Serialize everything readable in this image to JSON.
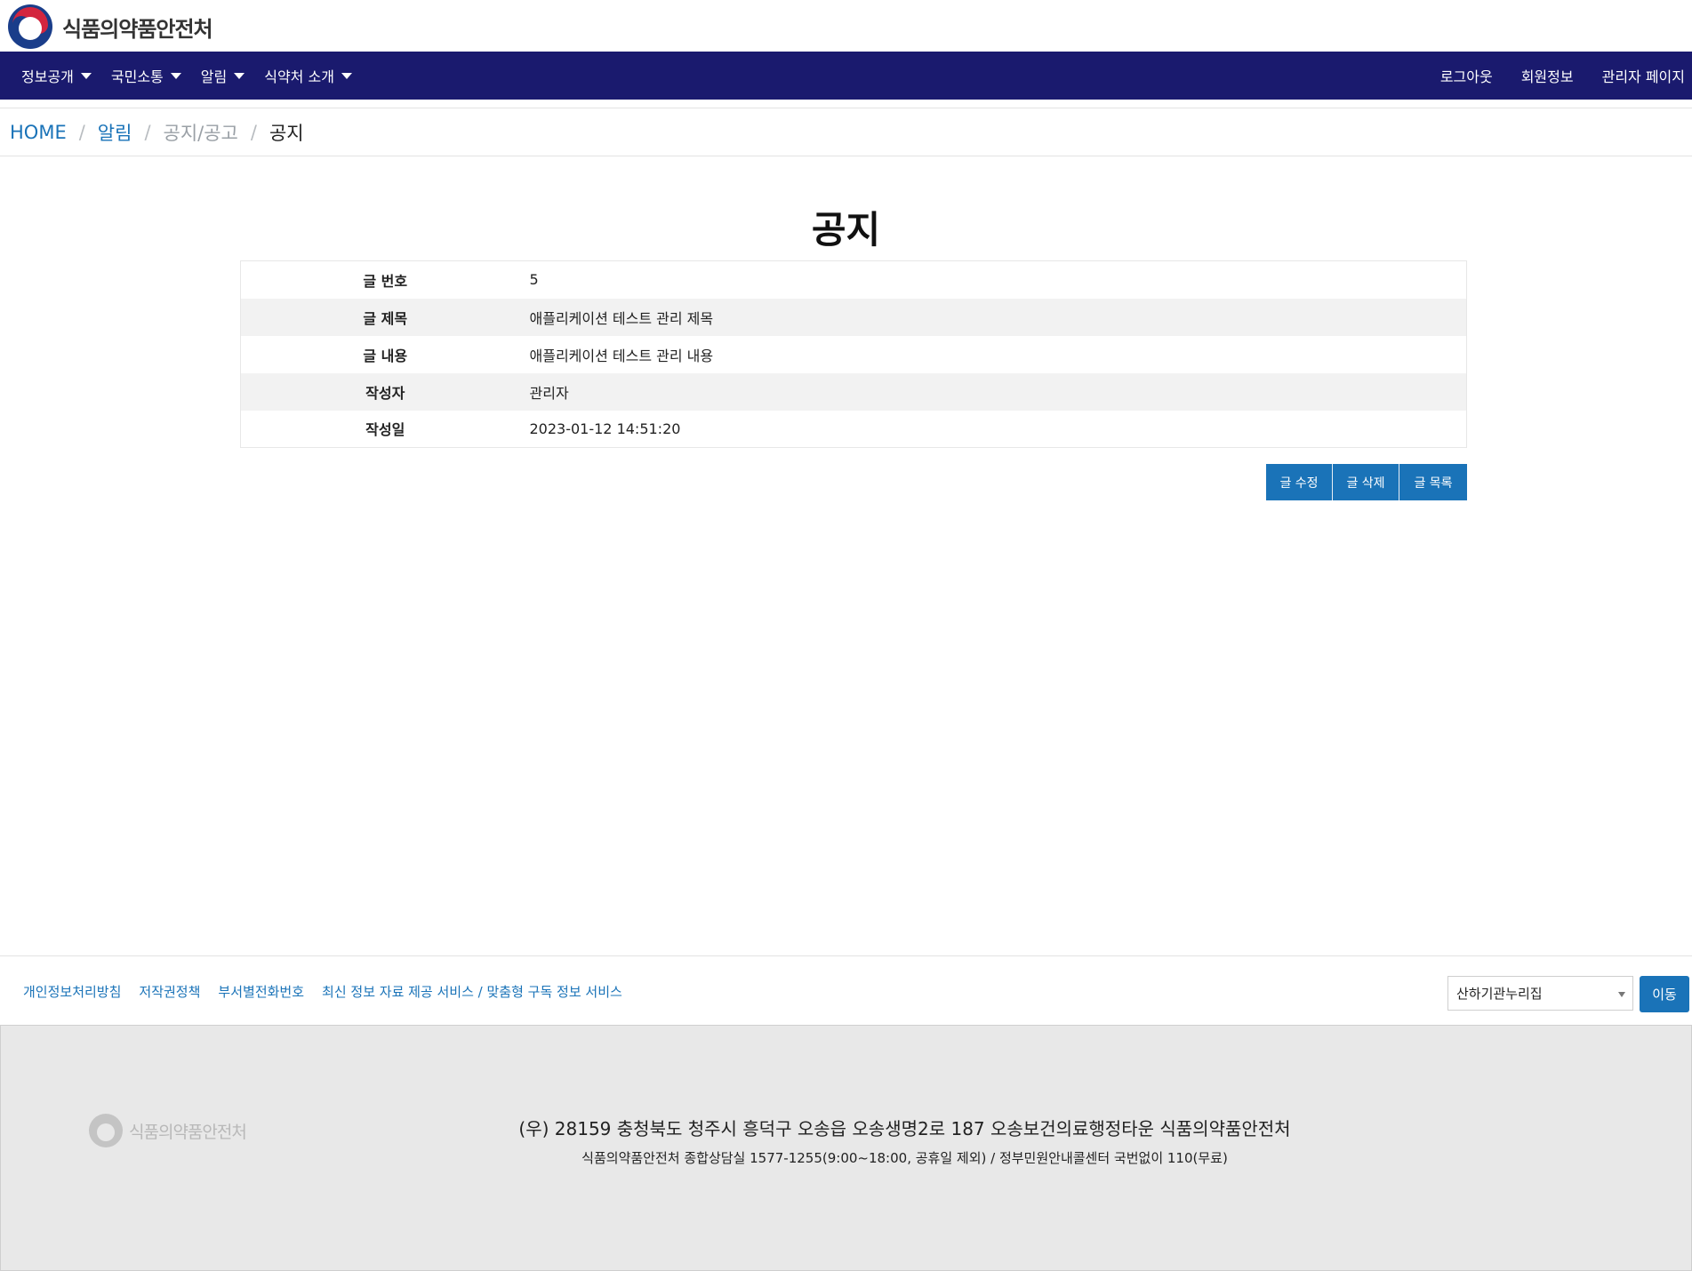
{
  "header": {
    "logo_text": "식품의약품안전처"
  },
  "nav": {
    "left": [
      {
        "label": "정보공개"
      },
      {
        "label": "국민소통"
      },
      {
        "label": "알림"
      },
      {
        "label": "식약처 소개"
      }
    ],
    "right": [
      {
        "label": "로그아웃"
      },
      {
        "label": "회원정보"
      },
      {
        "label": "관리자 페이지"
      }
    ]
  },
  "breadcrumb": {
    "home": "HOME",
    "level1": "알림",
    "level2": "공지/공고",
    "current": "공지",
    "separator": "/"
  },
  "page": {
    "title": "공지"
  },
  "detail": {
    "rows": [
      {
        "label": "글 번호",
        "value": "5"
      },
      {
        "label": "글 제목",
        "value": "애플리케이션 테스트 관리 제목"
      },
      {
        "label": "글 내용",
        "value": "애플리케이션 테스트 관리 내용"
      },
      {
        "label": "작성자",
        "value": "관리자"
      },
      {
        "label": "작성일",
        "value": "2023-01-12 14:51:20"
      }
    ]
  },
  "actions": {
    "edit": "글 수정",
    "delete": "글 삭제",
    "list": "글 목록"
  },
  "footer": {
    "links": [
      "개인정보처리방침",
      "저작권정책",
      "부서별전화번호",
      "최신 정보 자료 제공 서비스 / 맞춤형 구독 정보 서비스"
    ],
    "select_value": "산하기관누리집",
    "go_label": "이동",
    "logo_text": "식품의약품안전처",
    "address": "(우) 28159 충청북도 청주시 흥덕구 오송읍 오송생명2로 187 오송보건의료행정타운 식품의약품안전처",
    "contact": "식품의약품안전처 종합상담실 1577-1255(9:00~18:00, 공휴일 제외) / 정부민원안내콜센터 국번없이 110(무료)"
  },
  "colors": {
    "navbar": "#1a1a6e",
    "accent": "#1a73b8",
    "footer_bg": "#e8e8e8"
  }
}
